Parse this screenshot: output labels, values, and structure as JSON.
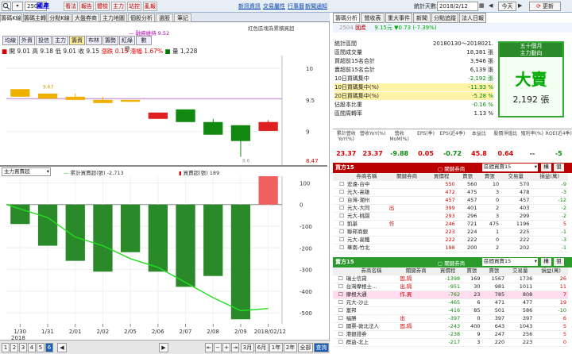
{
  "topbar": {
    "stock_code": "2504",
    "stock_name": "國產",
    "buttons": [
      "看法",
      "報告",
      "體檢",
      "主力",
      "站控",
      "亂報"
    ],
    "links": [
      "新訊資訊",
      "交易屬性",
      "行事曆",
      "新聞通知"
    ],
    "date_label": "統計天數:",
    "date_value": "2018/2/12",
    "today_btn": "今天",
    "refresh_btn": "更新"
  },
  "left_tabs": [
    "籌碼K線",
    "籌碼主轉",
    "分點K線",
    "大盤券商",
    "主力地圖",
    "個股分析",
    "選股",
    "筆記"
  ],
  "hint_text": "紅色區塊為累積買超",
  "indicator_btns": [
    "均線",
    "外資",
    "投信",
    "主力",
    "籌資",
    "布林",
    "籌勢",
    "紅綠燈",
    "數"
  ],
  "ohlc": {
    "open_label": "開",
    "open": "9.01",
    "high_label": "高",
    "high": "9.18",
    "low_label": "低",
    "low": "9.01",
    "close_label": "收",
    "close": "9.15",
    "chg_label": "漲跌",
    "chg": "0.15",
    "pct_label": "漲幅",
    "pct": "1.67%",
    "vol_label": "量",
    "vol": "1,228"
  },
  "legend_main": "融資維持 9.52",
  "price_axis": [
    "10",
    "9.5",
    "9",
    "8.47"
  ],
  "price_labels": {
    "hi": "9.67",
    "lo": "8.6"
  },
  "lower_panel": {
    "select": "主力買賣超",
    "legend1": "累計買賣超(張) -2,713",
    "legend2": "買賣超(張) 189",
    "axis": [
      "100",
      "0",
      "-100",
      "-200",
      "-300",
      "-400",
      "-500"
    ]
  },
  "xaxis": [
    "1/30",
    "1/31",
    "2/01",
    "2/02",
    "2/05",
    "2/06",
    "2/07",
    "2/08",
    "2/09",
    "2018/02/12"
  ],
  "xaxis_year": "2018",
  "chart_data": {
    "type": "candlestick",
    "dates": [
      "1/30",
      "1/31",
      "2/01",
      "2/02",
      "2/05",
      "2/06",
      "2/07",
      "2/08",
      "2/09",
      "2/12"
    ],
    "candles": [
      [
        9.67,
        9.67,
        9.55,
        9.55
      ],
      [
        9.6,
        9.6,
        9.52,
        9.52
      ],
      [
        9.55,
        9.6,
        9.5,
        9.5
      ],
      [
        9.5,
        9.55,
        9.45,
        9.45
      ],
      [
        9.5,
        9.5,
        9.47,
        9.47
      ],
      [
        9.2,
        9.3,
        9.2,
        9.3
      ],
      [
        9.35,
        9.35,
        9.15,
        9.15
      ],
      [
        9.15,
        9.2,
        8.95,
        8.95
      ],
      [
        9.1,
        9.1,
        8.6,
        8.85
      ],
      [
        9.01,
        9.18,
        9.01,
        9.15
      ]
    ],
    "ylim": [
      8.47,
      10.2
    ],
    "net": [
      -90,
      -190,
      -260,
      -310,
      -220,
      -310,
      -380,
      -330,
      -530,
      189
    ],
    "cum": [
      0,
      -60,
      -150,
      -190,
      -250,
      -290,
      -360,
      -430,
      -490,
      -480
    ],
    "net_ylim": [
      -540,
      120
    ]
  },
  "bottom_buttons": [
    "3月",
    "6月",
    "1年",
    "2年",
    "全部",
    "查詢"
  ],
  "period_nums": [
    "1",
    "2",
    "3",
    "4",
    "5",
    "6"
  ],
  "right": {
    "tabs": [
      "籌碼分析",
      "營收表",
      "重大事件",
      "新聞",
      "分點追蹤",
      "法人日報"
    ],
    "code": "2504",
    "name": "國產",
    "price": "9.15元",
    "change": "▼0.73 (-7.39%)",
    "stats": [
      [
        "統計區間",
        "20180130～2018021."
      ],
      [
        "區間成交量",
        "18,381 張"
      ],
      [
        "買超前15名合計",
        "3,946 張"
      ],
      [
        "賣超前15名合計",
        "6,139 張"
      ],
      [
        "10日買碼集中",
        "-2,192 張"
      ],
      [
        "10日買碼集中(%)",
        "-11.93 %"
      ],
      [
        "20日買碼集中(%)",
        "-5.28 %"
      ],
      [
        "佔股本比重",
        "-0.16 %"
      ],
      [
        "區間周轉率",
        "1.13 %"
      ]
    ],
    "flow_title": "五十個月",
    "flow_sub": "主力動向",
    "flow_big": "大賣",
    "flow_val": "2,192 張",
    "eps_headers": [
      "累計營收YoY(%)",
      "營收YoY(%)",
      "營收MoM(%)",
      "EPS(季)",
      "EPS(近4季)",
      "本益比",
      "股價淨值比",
      "殖利率(%)",
      "ROE(近4季)"
    ],
    "eps_values": [
      "23.37",
      "23.37",
      "-9.88",
      "0.05",
      "-0.72",
      "45.8",
      "0.64",
      "--",
      "-5"
    ],
    "buy_title": "買方15",
    "sell_title": "賣方15",
    "filter_label": "關鍵券商",
    "filter_value": "區間買賣15",
    "btn1": "構",
    "btn2": "狙",
    "cols": [
      "券商名稱",
      "關鍵券商",
      "買價程",
      "賣張",
      "賣張",
      "交易量",
      "損益(萬)"
    ],
    "buy": [
      [
        "宏遠-台中",
        "",
        "550",
        "560",
        "10",
        "570",
        "-9"
      ],
      [
        "元大-高雄",
        "",
        "472",
        "475",
        "3",
        "478",
        "-3"
      ],
      [
        "台灣-潮州",
        "",
        "457",
        "457",
        "0",
        "457",
        "-12"
      ],
      [
        "元大-大同",
        "出",
        "399",
        "401",
        "2",
        "403",
        "-2"
      ],
      [
        "元大-桃園",
        "",
        "293",
        "296",
        "3",
        "299",
        "-2"
      ],
      [
        "凱基",
        "作",
        "246",
        "721",
        "475",
        "1196",
        "5"
      ],
      [
        "聯邦商銀",
        "",
        "223",
        "224",
        "1",
        "225",
        "-1"
      ],
      [
        "元大-高鐵",
        "",
        "222",
        "222",
        "0",
        "222",
        "-3"
      ],
      [
        "華南-竹北",
        "",
        "198",
        "200",
        "2",
        "202",
        "-1"
      ]
    ],
    "sell": [
      [
        "瑞士信貸",
        "固,隔",
        "-1398",
        "169",
        "1567",
        "1736",
        "26"
      ],
      [
        "台灣摩根士…",
        "出,隔",
        "-951",
        "30",
        "981",
        "1011",
        "11"
      ],
      [
        "摩根大通",
        "作,買",
        "-762",
        "23",
        "785",
        "808",
        "7"
      ],
      [
        "元大-沙止",
        "",
        "-465",
        "6",
        "471",
        "477",
        "19"
      ],
      [
        "富邦",
        "",
        "-416",
        "85",
        "501",
        "586",
        "-10"
      ],
      [
        "福勝",
        "出",
        "-397",
        "0",
        "397",
        "397",
        "6"
      ],
      [
        "國票-敦北法人",
        "固,隔",
        "-243",
        "400",
        "643",
        "1043",
        "5"
      ],
      [
        "港銀證券",
        "",
        "-238",
        "9",
        "247",
        "256",
        "5"
      ],
      [
        "群益-北上",
        "",
        "-217",
        "3",
        "220",
        "223",
        "0"
      ]
    ]
  }
}
